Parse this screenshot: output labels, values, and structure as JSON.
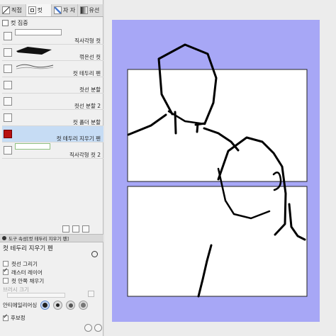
{
  "tool_tabs": [
    {
      "label": "직접",
      "icon": "pen-icon"
    },
    {
      "label": "컷",
      "icon": "frame-icon"
    },
    {
      "label": "자 자",
      "icon": "ruler-icon"
    },
    {
      "label": "유선",
      "icon": "gradient-icon"
    }
  ],
  "group_label": "컷 집중",
  "subtools": [
    {
      "label": "직사각형 컷",
      "icon": "rect-frame-icon",
      "preview": "box"
    },
    {
      "label": "꺾은선 컷",
      "icon": "polyline-frame-icon",
      "preview": "polygon"
    },
    {
      "label": "컷 테두리 펜",
      "icon": "border-pen-icon",
      "preview": "wave"
    },
    {
      "label": "컷선 분할",
      "icon": "split-line-icon",
      "preview": "none"
    },
    {
      "label": "컷선 분할 2",
      "icon": "split-line-icon-2",
      "preview": "none"
    },
    {
      "label": "컷 폴더 분할",
      "icon": "folder-split-icon",
      "preview": "none"
    },
    {
      "label": "컷 테두리 지우기 펜",
      "icon": "eraser-pen-icon",
      "preview": "none",
      "selected": true
    },
    {
      "label": "직사각형 컷 2",
      "icon": "rect-frame-icon-2",
      "preview": "input"
    }
  ],
  "sub_tab_label": "도구 속성[컷 테두리 지우기 펜]",
  "props_title": "컷 테두리 지우기 펜",
  "properties": [
    {
      "label": "컷선 그리기",
      "checked": false,
      "dim": false
    },
    {
      "label": "래스터 레이어",
      "checked": true,
      "dim": false
    },
    {
      "label": "컷 안쪽 채우기",
      "checked": false,
      "dim": false
    },
    {
      "label": "브러시 크기",
      "checked": false,
      "dim": true
    }
  ],
  "antialias_label": "안티에일리어싱",
  "correction_label": "후보정",
  "colors": {
    "paper": "#a7a7f6",
    "selected_row": "#c6dcf4",
    "eraser_icon": "#b81010"
  }
}
